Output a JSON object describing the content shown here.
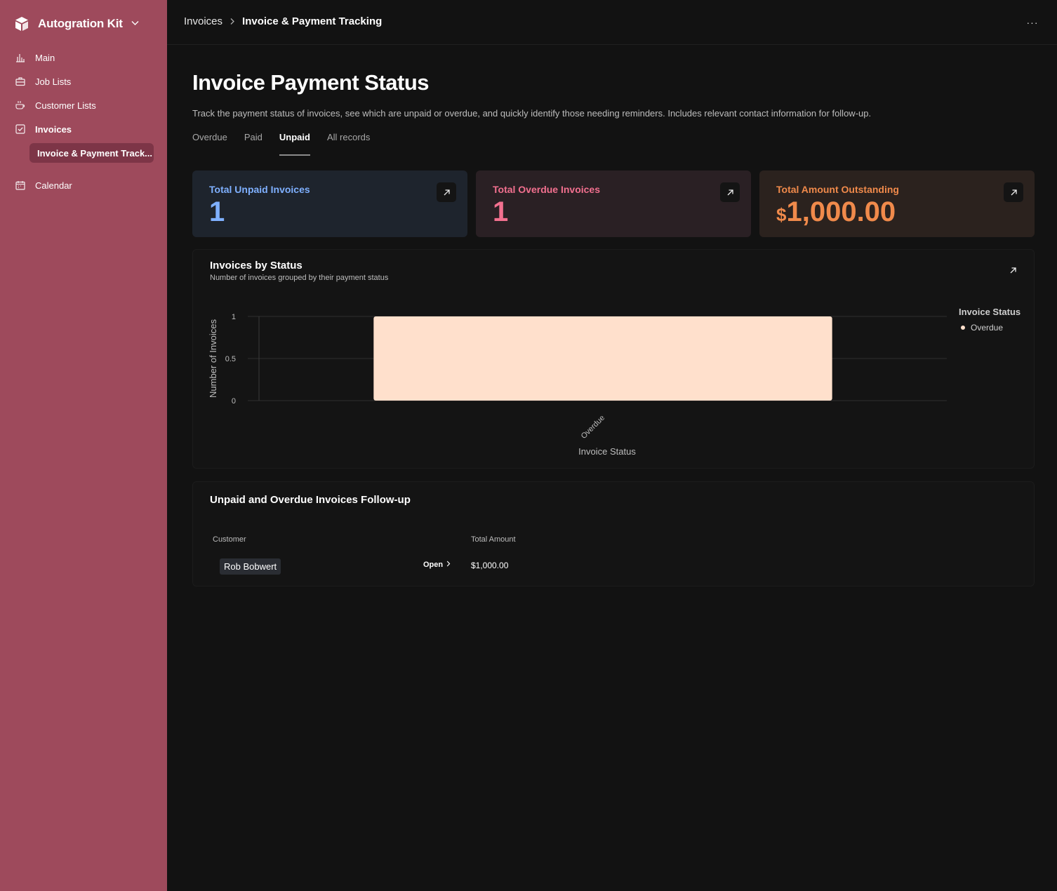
{
  "sidebar": {
    "workspace": "Autogration Kit",
    "items": [
      {
        "label": "Main",
        "icon": "bar-chart-icon"
      },
      {
        "label": "Job Lists",
        "icon": "briefcase-icon"
      },
      {
        "label": "Customer Lists",
        "icon": "coffee-cup-icon"
      },
      {
        "label": "Invoices",
        "icon": "checkbox-icon"
      },
      {
        "label": "Invoice & Payment Track...",
        "icon": ""
      },
      {
        "label": "Calendar",
        "icon": "calendar-icon"
      }
    ],
    "color": "#9e4a5c"
  },
  "header": {
    "breadcrumb_parent": "Invoices",
    "breadcrumb_current": "Invoice & Payment Tracking",
    "more_label": "···"
  },
  "page": {
    "title": "Invoice Payment Status",
    "description": "Track the payment status of invoices, see which are unpaid or overdue, and quickly identify those needing reminders. Includes relevant contact information for follow-up.",
    "tabs": [
      "Overdue",
      "Paid",
      "Unpaid",
      "All records"
    ],
    "active_tab": "Unpaid"
  },
  "kpis": [
    {
      "label": "Total Unpaid Invoices",
      "value": "1",
      "currency": "",
      "color": "#7fb0ff",
      "bg": "#1e242d"
    },
    {
      "label": "Total Overdue Invoices",
      "value": "1",
      "currency": "",
      "color": "#f2708f",
      "bg": "#2a2024"
    },
    {
      "label": "Total Amount Outstanding",
      "value": "1,000.00",
      "currency": "$",
      "color": "#f08a4b",
      "bg": "#2b221e"
    }
  ],
  "chart_card": {
    "title": "Invoices by Status",
    "subtitle": "Number of invoices grouped by their payment status"
  },
  "chart_data": {
    "type": "bar",
    "categories": [
      "Overdue"
    ],
    "values": [
      1
    ],
    "xlabel": "Invoice Status",
    "ylabel": "Number of Invoices",
    "ylim": [
      0,
      1
    ],
    "yticks": [
      "0",
      "0.5",
      "1"
    ],
    "legend_title": "Invoice Status",
    "legend": [
      "Overdue"
    ],
    "legend_position": "right",
    "bar_color": "#ffe0cc",
    "grid": true
  },
  "followup": {
    "title": "Unpaid and Overdue Invoices Follow-up",
    "columns": [
      "Customer",
      "Total Amount"
    ],
    "rows": [
      {
        "customer": "Rob Bobwert",
        "open_label": "Open",
        "amount": "$1,000.00"
      }
    ]
  }
}
